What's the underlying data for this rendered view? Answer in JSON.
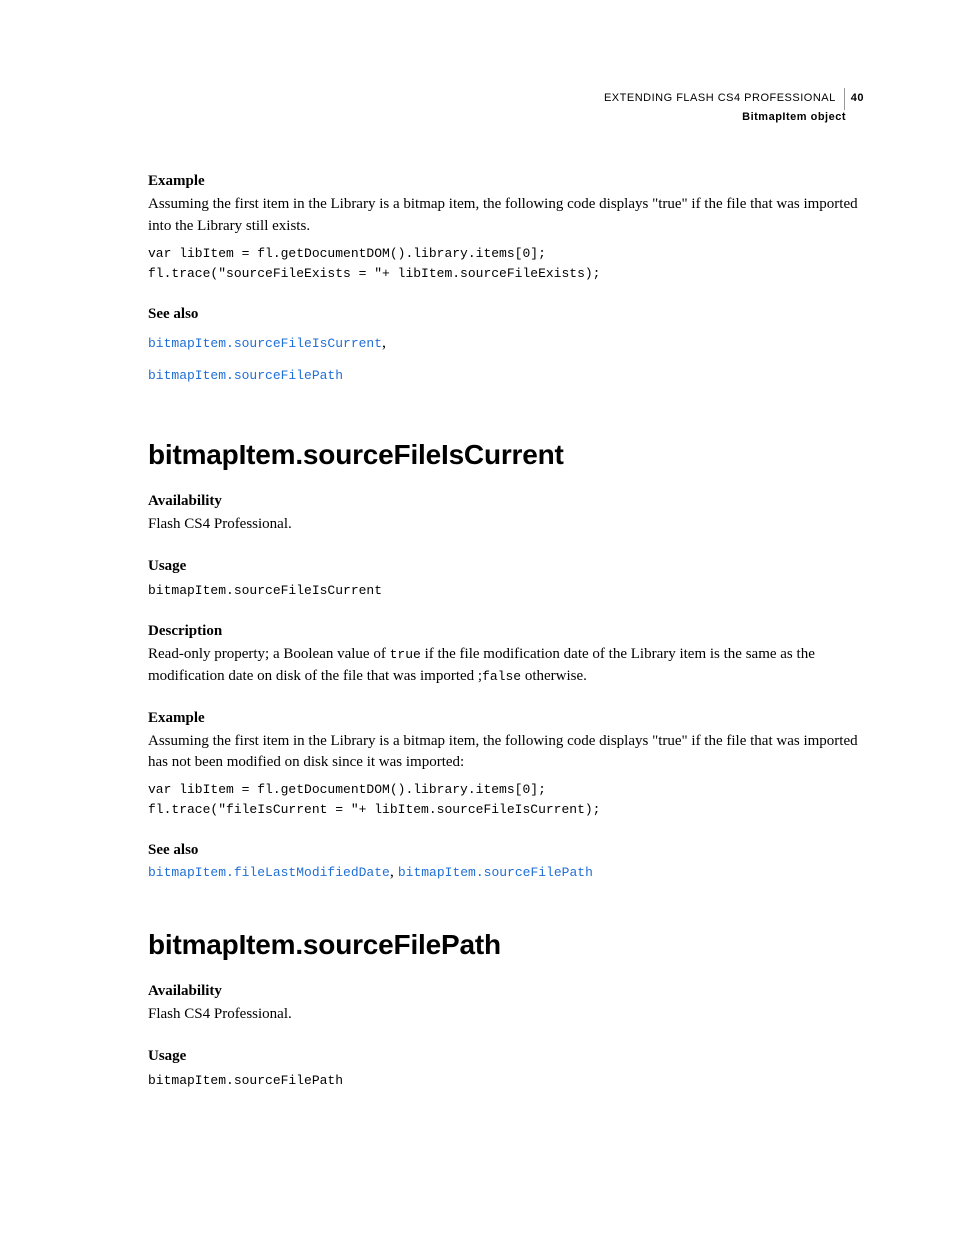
{
  "header": {
    "book_title": "EXTENDING FLASH CS4 PROFESSIONAL",
    "page_number": "40",
    "section_title": "BitmapItem object"
  },
  "top_example": {
    "label": "Example",
    "intro": "Assuming the first item in the Library is a bitmap item, the following code displays \"true\" if the file that was imported into the Library still exists.",
    "code": "var libItem = fl.getDocumentDOM().library.items[0];\nfl.trace(\"sourceFileExists = \"+ libItem.sourceFileExists);"
  },
  "top_see_also": {
    "label": "See also",
    "link1": "bitmapItem.sourceFileIsCurrent",
    "sep": ",",
    "link2": "bitmapItem.sourceFilePath"
  },
  "section1": {
    "title": "bitmapItem.sourceFileIsCurrent",
    "availability_label": "Availability",
    "availability_text": "Flash CS4 Professional.",
    "usage_label": "Usage",
    "usage_code": "bitmapItem.sourceFileIsCurrent",
    "description_label": "Description",
    "description_pre": "Read-only property; a Boolean value of ",
    "description_true": "true",
    "description_mid": " if the file modification date of the Library item is the same as the modification date on disk of the file that was imported ;",
    "description_false": "false",
    "description_post": " otherwise.",
    "example_label": "Example",
    "example_intro": "Assuming the first item in the Library is a bitmap item, the following code displays \"true\" if the file that was imported has not been modified on disk since it was imported:",
    "example_code": "var libItem = fl.getDocumentDOM().library.items[0];\nfl.trace(\"fileIsCurrent = \"+ libItem.sourceFileIsCurrent);",
    "see_also_label": "See also",
    "see_also_link1": "bitmapItem.fileLastModifiedDate",
    "see_also_sep": ", ",
    "see_also_link2": "bitmapItem.sourceFilePath"
  },
  "section2": {
    "title": "bitmapItem.sourceFilePath",
    "availability_label": "Availability",
    "availability_text": "Flash CS4 Professional.",
    "usage_label": "Usage",
    "usage_code": "bitmapItem.sourceFilePath"
  }
}
